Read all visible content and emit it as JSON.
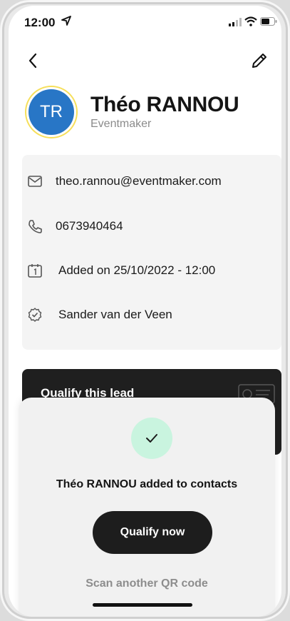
{
  "status_bar": {
    "time": "12:00"
  },
  "contact": {
    "initials": "TR",
    "name": "Théo RANNOU",
    "company": "Eventmaker",
    "email": "theo.rannou@eventmaker.com",
    "phone": "0673940464",
    "added_on": "Added on 25/10/2022 - 12:00",
    "added_by": "Sander van der Veen"
  },
  "qualify_card": {
    "title": "Qualify this lead"
  },
  "sheet": {
    "message": "Théo RANNOU added to contacts",
    "primary_button": "Qualify now",
    "secondary_link": "Scan another QR code"
  },
  "colors": {
    "avatar": "#2876c6",
    "avatar_ring": "#f6df5a",
    "success_bg": "#c9f4df",
    "button_bg": "#1d1d1d"
  }
}
